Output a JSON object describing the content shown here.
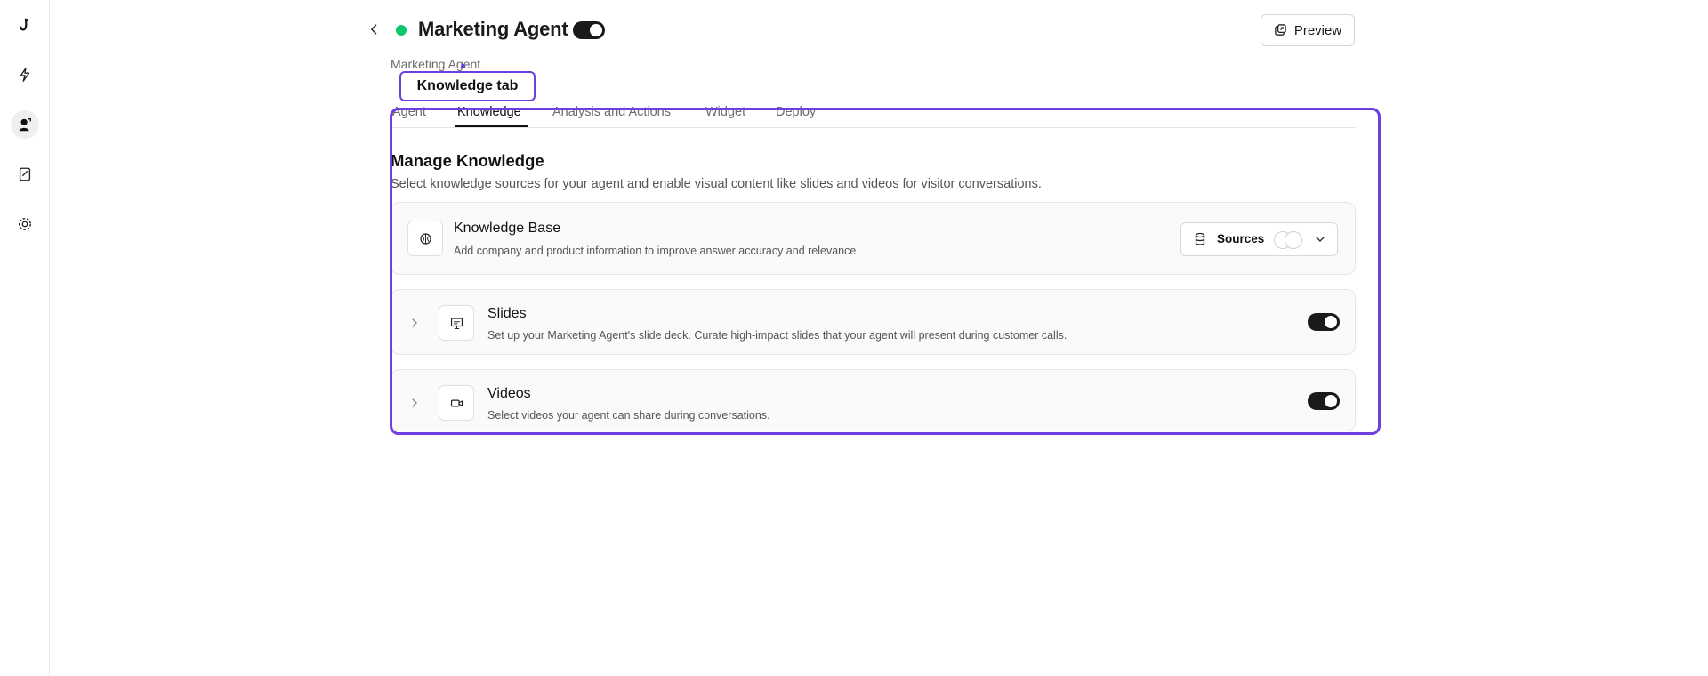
{
  "header": {
    "title": "Marketing Agent",
    "status_color": "#10c66b",
    "preview_label": "Preview",
    "breadcrumb": "Marketing Agent"
  },
  "tooltip": {
    "label": "Knowledge tab"
  },
  "tabs": [
    {
      "label": "Agent",
      "active": false
    },
    {
      "label": "Knowledge",
      "active": true
    },
    {
      "label": "Analysis and Actions",
      "active": false
    },
    {
      "label": "Widget",
      "active": false
    },
    {
      "label": "Deploy",
      "active": false
    }
  ],
  "section": {
    "title": "Manage Knowledge",
    "description": "Select knowledge sources for your agent and enable visual content like slides and videos for visitor conversations."
  },
  "knowledge_base": {
    "title": "Knowledge Base",
    "description": "Add company and product information to improve answer accuracy and relevance.",
    "sources_label": "Sources"
  },
  "slides": {
    "title": "Slides",
    "description": "Set up your Marketing Agent's slide deck. Curate high-impact slides that your agent will present during customer calls.",
    "enabled": true
  },
  "videos": {
    "title": "Videos",
    "description": "Select videos your agent can share during conversations.",
    "enabled": true
  },
  "colors": {
    "accent": "#6b3fe0",
    "toggle_on": "#1a1a1a"
  },
  "icons": {
    "rail": [
      "logo-icon",
      "flash-icon",
      "agent-icon",
      "knowledge-icon",
      "gear-icon"
    ]
  }
}
